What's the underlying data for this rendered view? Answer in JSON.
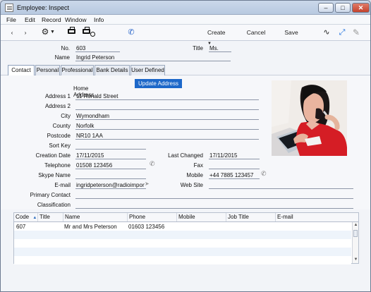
{
  "window": {
    "title": "Employee: Inspect",
    "controls": {
      "minimize": "–",
      "maximize": "□",
      "close": "✕"
    }
  },
  "menu": [
    "File",
    "Edit",
    "Record",
    "Window",
    "Info"
  ],
  "toolbar": {
    "create": "Create",
    "cancel": "Cancel",
    "save": "Save",
    "icons": [
      "back-icon",
      "forward-icon",
      "gear-icon",
      "print-icon",
      "print-preview-icon",
      "phone-icon",
      "activity-icon",
      "expand-icon",
      "attachment-icon"
    ]
  },
  "header": {
    "no_label": "No.",
    "no_value": "603",
    "title_label": "Title",
    "title_value": "Ms.",
    "name_label": "Name",
    "name_value": "Ingrid Peterson"
  },
  "tabs": [
    {
      "label": "Contact",
      "active": true
    },
    {
      "label": "Personal",
      "active": false
    },
    {
      "label": "Professional",
      "active": false
    },
    {
      "label": "Bank Details",
      "active": false
    },
    {
      "label": "User Defined",
      "active": false
    }
  ],
  "contact": {
    "home_address_label": "Home Address",
    "update_address_button": "Update Address",
    "address1_label": "Address 1",
    "address1_value": "11 Ronald Street",
    "address2_label": "Address 2",
    "address2_value": "",
    "city_label": "City",
    "city_value": "Wymondham",
    "county_label": "County",
    "county_value": "Norfolk",
    "postcode_label": "Postcode",
    "postcode_value": "NR10 1AA",
    "sortkey_label": "Sort Key",
    "sortkey_value": "",
    "creation_date_label": "Creation Date",
    "creation_date_value": "17/11/2015",
    "last_changed_label": "Last Changed",
    "last_changed_value": "17/11/2015",
    "telephone_label": "Telephone",
    "telephone_value": "01508 123456",
    "fax_label": "Fax",
    "fax_value": "",
    "skype_label": "Skype Name",
    "skype_value": "",
    "mobile_label": "Mobile",
    "mobile_value": "+44 7885 123457",
    "email_label": "E-mail",
    "email_value": "ingridpeterson@radioimporte",
    "website_label": "Web Site",
    "website_value": "",
    "primary_contact_label": "Primary Contact",
    "primary_contact_value": "",
    "classification_label": "Classification",
    "classification_value": ""
  },
  "table": {
    "columns": [
      "Code",
      "Title",
      "Name",
      "Phone",
      "Mobile",
      "Job Title",
      "E-mail"
    ],
    "rows": [
      [
        "607",
        "",
        "Mr and Mrs Peterson",
        "01603 123456",
        "",
        "",
        ""
      ]
    ],
    "sort_indicator": "▲"
  },
  "colors": {
    "accent": "#1d68c9",
    "window_frame": "#6d7b91",
    "tab_background": "#e8ecf3",
    "table_stripe": "#eef4fb"
  }
}
